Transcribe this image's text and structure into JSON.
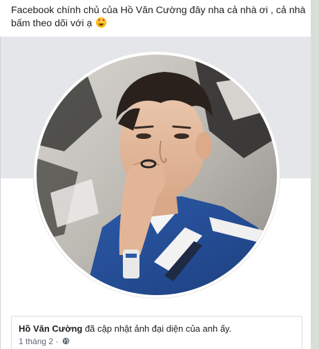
{
  "post": {
    "caption": "Facebook chính chủ của Hồ Văn Cường đây nha cả nhà ơi , cả nhà bấm theo dõi với ạ",
    "emoji_icon": "heart-eyes-emoji-icon"
  },
  "profile_photo": {
    "subject_icon": "profile-photo",
    "ring_color": "#ffffff",
    "cover_color": "#e4e6ea"
  },
  "update_card": {
    "author_name": "Hồ Văn Cường",
    "action_text": " đã cập nhật ảnh đại diện của anh ấy.",
    "timestamp": "1 tháng 2",
    "separator": " · ",
    "privacy_icon": "globe-icon"
  }
}
